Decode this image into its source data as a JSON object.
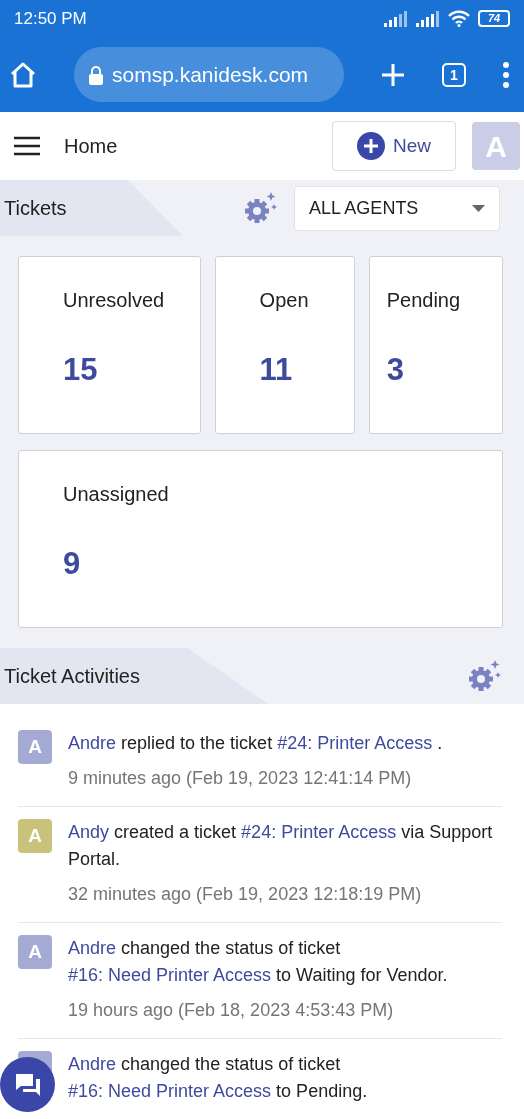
{
  "status_bar": {
    "time": "12:50 PM",
    "battery": "74"
  },
  "browser": {
    "url": "somsp.kanidesk.com",
    "tab_count": "1"
  },
  "header": {
    "title": "Home",
    "new_button": "New",
    "avatar": "A"
  },
  "tickets": {
    "title": "Tickets",
    "agent_filter": "ALL AGENTS",
    "cards": [
      {
        "label": "Unresolved",
        "count": "15"
      },
      {
        "label": "Open",
        "count": "11"
      },
      {
        "label": "Pending",
        "count": "3"
      },
      {
        "label": "Unassigned",
        "count": "9"
      }
    ]
  },
  "activities": {
    "title": "Ticket Activities",
    "items": [
      {
        "avatar": "A",
        "color": "#a4aad4",
        "parts": [
          {
            "kind": "user",
            "text": "Andre"
          },
          {
            "kind": "text",
            "text": " replied to the ticket "
          },
          {
            "kind": "ticket",
            "text": "#24: Printer Access"
          },
          {
            "kind": "text",
            "text": " ."
          }
        ],
        "time": "9 minutes ago (Feb 19, 2023 12:41:14 PM)"
      },
      {
        "avatar": "A",
        "color": "#c9c27a",
        "parts": [
          {
            "kind": "user",
            "text": "Andy"
          },
          {
            "kind": "text",
            "text": " created a ticket "
          },
          {
            "kind": "ticket",
            "text": "#24: Printer Access"
          },
          {
            "kind": "text",
            "text": " via Support Portal."
          }
        ],
        "time": "32 minutes ago (Feb 19, 2023 12:18:19 PM)"
      },
      {
        "avatar": "A",
        "color": "#a4aad4",
        "parts": [
          {
            "kind": "user",
            "text": "Andre"
          },
          {
            "kind": "text",
            "text": " changed the status of ticket "
          },
          {
            "kind": "ticket",
            "text": "#16: Need Printer Access"
          },
          {
            "kind": "text",
            "text": " to Waiting for Vendor."
          }
        ],
        "time": "19 hours ago (Feb 18, 2023 4:53:43 PM)"
      },
      {
        "color": "#a4aad4",
        "parts": [
          {
            "kind": "user",
            "text": "Andre"
          },
          {
            "kind": "text",
            "text": " changed the status of ticket "
          },
          {
            "kind": "ticket",
            "text": "#16: Need Printer Access"
          },
          {
            "kind": "text",
            "text": " to Pending."
          }
        ]
      }
    ]
  }
}
